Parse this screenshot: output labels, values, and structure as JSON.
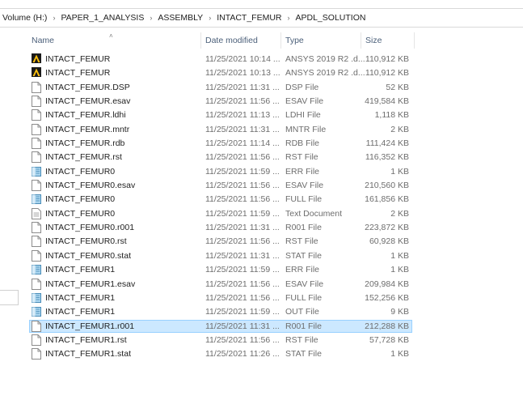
{
  "breadcrumb": [
    "Volume (H:)",
    "PAPER_1_ANALYSIS",
    "ASSEMBLY",
    "INTACT_FEMUR",
    "APDL_SOLUTION"
  ],
  "columns": {
    "name": "Name",
    "date": "Date modified",
    "type": "Type",
    "size": "Size"
  },
  "files": [
    {
      "name": "INTACT_FEMUR",
      "date": "11/25/2021 10:14 ...",
      "type": "ANSYS 2019 R2 .d...",
      "size": "110,912 KB",
      "icon": "ansys-icon"
    },
    {
      "name": "INTACT_FEMUR",
      "date": "11/25/2021 10:13 ...",
      "type": "ANSYS 2019 R2 .d...",
      "size": "110,912 KB",
      "icon": "ansys-icon"
    },
    {
      "name": "INTACT_FEMUR.DSP",
      "date": "11/25/2021 11:31 ...",
      "type": "DSP File",
      "size": "52 KB",
      "icon": "file-icon"
    },
    {
      "name": "INTACT_FEMUR.esav",
      "date": "11/25/2021 11:56 ...",
      "type": "ESAV File",
      "size": "419,584 KB",
      "icon": "file-icon"
    },
    {
      "name": "INTACT_FEMUR.ldhi",
      "date": "11/25/2021 11:13 ...",
      "type": "LDHI File",
      "size": "1,118 KB",
      "icon": "file-icon"
    },
    {
      "name": "INTACT_FEMUR.mntr",
      "date": "11/25/2021 11:31 ...",
      "type": "MNTR File",
      "size": "2 KB",
      "icon": "file-icon"
    },
    {
      "name": "INTACT_FEMUR.rdb",
      "date": "11/25/2021 11:14 ...",
      "type": "RDB File",
      "size": "111,424 KB",
      "icon": "file-icon"
    },
    {
      "name": "INTACT_FEMUR.rst",
      "date": "11/25/2021 11:56 ...",
      "type": "RST File",
      "size": "116,352 KB",
      "icon": "file-icon"
    },
    {
      "name": "INTACT_FEMUR0",
      "date": "11/25/2021 11:59 ...",
      "type": "ERR File",
      "size": "1 KB",
      "icon": "text-file-icon"
    },
    {
      "name": "INTACT_FEMUR0.esav",
      "date": "11/25/2021 11:56 ...",
      "type": "ESAV File",
      "size": "210,560 KB",
      "icon": "file-icon"
    },
    {
      "name": "INTACT_FEMUR0",
      "date": "11/25/2021 11:56 ...",
      "type": "FULL File",
      "size": "161,856 KB",
      "icon": "text-file-icon"
    },
    {
      "name": "INTACT_FEMUR0",
      "date": "11/25/2021 11:59 ...",
      "type": "Text Document",
      "size": "2 KB",
      "icon": "text-document-icon"
    },
    {
      "name": "INTACT_FEMUR0.r001",
      "date": "11/25/2021 11:31 ...",
      "type": "R001 File",
      "size": "223,872 KB",
      "icon": "file-icon"
    },
    {
      "name": "INTACT_FEMUR0.rst",
      "date": "11/25/2021 11:56 ...",
      "type": "RST File",
      "size": "60,928 KB",
      "icon": "file-icon"
    },
    {
      "name": "INTACT_FEMUR0.stat",
      "date": "11/25/2021 11:31 ...",
      "type": "STAT File",
      "size": "1 KB",
      "icon": "file-icon"
    },
    {
      "name": "INTACT_FEMUR1",
      "date": "11/25/2021 11:59 ...",
      "type": "ERR File",
      "size": "1 KB",
      "icon": "text-file-icon"
    },
    {
      "name": "INTACT_FEMUR1.esav",
      "date": "11/25/2021 11:56 ...",
      "type": "ESAV File",
      "size": "209,984 KB",
      "icon": "file-icon"
    },
    {
      "name": "INTACT_FEMUR1",
      "date": "11/25/2021 11:56 ...",
      "type": "FULL File",
      "size": "152,256 KB",
      "icon": "text-file-icon"
    },
    {
      "name": "INTACT_FEMUR1",
      "date": "11/25/2021 11:59 ...",
      "type": "OUT File",
      "size": "9 KB",
      "icon": "text-file-icon"
    },
    {
      "name": "INTACT_FEMUR1.r001",
      "date": "11/25/2021 11:31 ...",
      "type": "R001 File",
      "size": "212,288 KB",
      "icon": "file-icon",
      "selected": true
    },
    {
      "name": "INTACT_FEMUR1.rst",
      "date": "11/25/2021 11:56 ...",
      "type": "RST File",
      "size": "57,728 KB",
      "icon": "file-icon"
    },
    {
      "name": "INTACT_FEMUR1.stat",
      "date": "11/25/2021 11:26 ...",
      "type": "STAT File",
      "size": "1 KB",
      "icon": "file-icon"
    }
  ],
  "colors": {
    "selection_bg": "#cce8ff",
    "selection_border": "#99d1ff",
    "header_text": "#4c607a",
    "ansys_yellow": "#ffc20e"
  }
}
